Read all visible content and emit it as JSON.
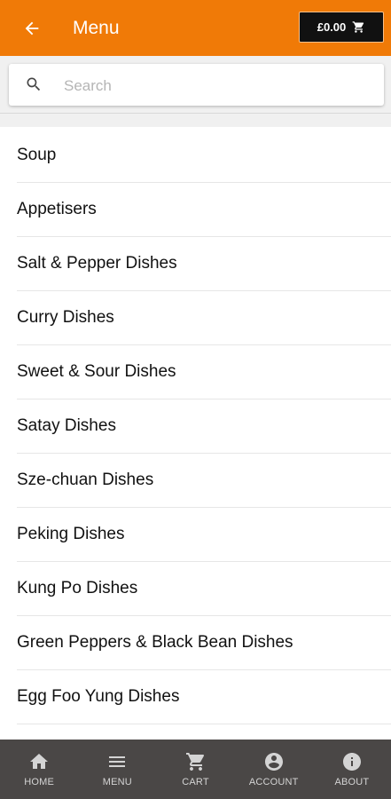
{
  "header": {
    "title": "Menu",
    "back_icon": "arrow-left-icon",
    "cart_total": "£0.00",
    "cart_icon": "shopping-cart-icon",
    "background_color": "#f07a07"
  },
  "search": {
    "placeholder": "Search",
    "value": "",
    "icon": "search-icon"
  },
  "menu": {
    "categories": [
      {
        "label": "Soup"
      },
      {
        "label": "Appetisers"
      },
      {
        "label": "Salt & Pepper Dishes"
      },
      {
        "label": "Curry Dishes"
      },
      {
        "label": "Sweet & Sour Dishes"
      },
      {
        "label": "Satay Dishes"
      },
      {
        "label": "Sze-chuan Dishes"
      },
      {
        "label": "Peking Dishes"
      },
      {
        "label": "Kung Po Dishes"
      },
      {
        "label": "Green Peppers & Black Bean Dishes"
      },
      {
        "label": "Egg Foo Yung Dishes"
      },
      {
        "label": ""
      }
    ]
  },
  "bottom_nav": {
    "background_color": "#4a4746",
    "items": [
      {
        "label": "HOME",
        "icon": "home-icon"
      },
      {
        "label": "MENU",
        "icon": "menu-icon"
      },
      {
        "label": "CART",
        "icon": "cart-icon"
      },
      {
        "label": "ACCOUNT",
        "icon": "account-icon"
      },
      {
        "label": "ABOUT",
        "icon": "info-icon"
      }
    ]
  }
}
